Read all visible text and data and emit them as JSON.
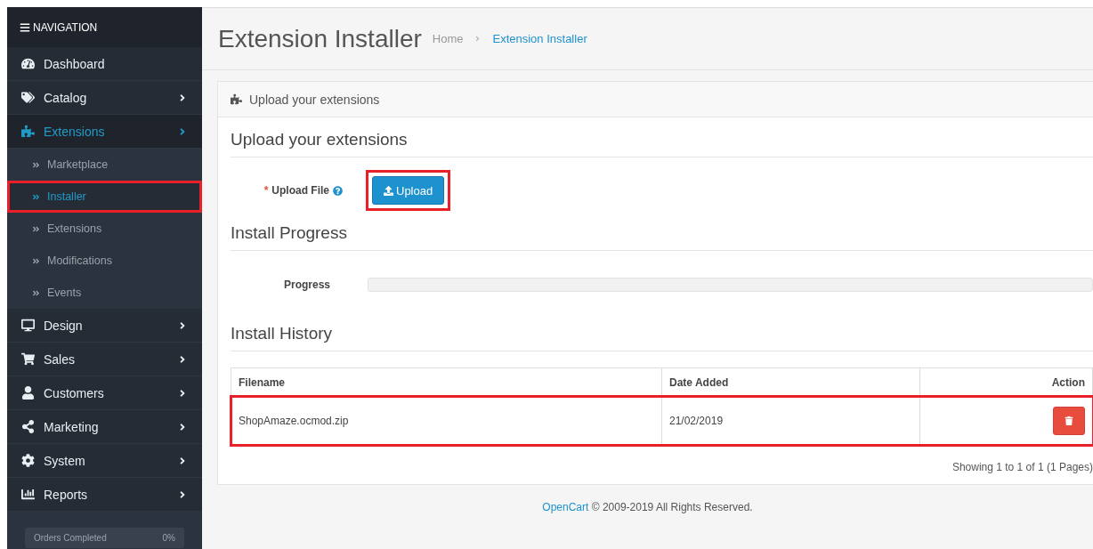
{
  "sidebar": {
    "header": "NAVIGATION",
    "items": [
      {
        "label": "Dashboard",
        "has_submenu": false,
        "selected": false
      },
      {
        "label": "Catalog",
        "has_submenu": true,
        "selected": false
      },
      {
        "label": "Extensions",
        "has_submenu": true,
        "expanded": true,
        "selected": true,
        "children": [
          {
            "label": "Marketplace",
            "selected": false,
            "highlighted": false
          },
          {
            "label": "Installer",
            "selected": true,
            "highlighted": true
          },
          {
            "label": "Extensions",
            "selected": false,
            "highlighted": false
          },
          {
            "label": "Modifications",
            "selected": false,
            "highlighted": false
          },
          {
            "label": "Events",
            "selected": false,
            "highlighted": false
          }
        ]
      },
      {
        "label": "Design",
        "has_submenu": true,
        "selected": false
      },
      {
        "label": "Sales",
        "has_submenu": true,
        "selected": false
      },
      {
        "label": "Customers",
        "has_submenu": true,
        "selected": false
      },
      {
        "label": "Marketing",
        "has_submenu": true,
        "selected": false
      },
      {
        "label": "System",
        "has_submenu": true,
        "selected": false
      },
      {
        "label": "Reports",
        "has_submenu": true,
        "selected": false
      }
    ],
    "stat": {
      "label": "Orders Completed",
      "value": "0%"
    }
  },
  "page": {
    "title": "Extension Installer",
    "breadcrumb": [
      {
        "label": "Home",
        "selected": false
      },
      {
        "label": "Extension Installer",
        "selected": true
      }
    ]
  },
  "panel": {
    "title": "Upload your extensions",
    "upload_section": {
      "heading": "Upload your extensions",
      "label": "Upload File",
      "required_mark": "*",
      "button": "Upload",
      "highlighted": true
    },
    "progress_section": {
      "heading": "Install Progress",
      "label": "Progress",
      "level": 0
    },
    "history_section": {
      "heading": "Install History",
      "columns": [
        "Filename",
        "Date Added",
        "Action"
      ],
      "rows": [
        {
          "filename": "ShopAmaze.ocmod.zip",
          "date_added": "21/02/2019",
          "highlighted": true
        }
      ],
      "pagination": "Showing 1 to 1 of 1 (1 Pages)"
    }
  },
  "footer": {
    "link": "OpenCart",
    "text": "© 2009-2019 All Rights Reserved."
  }
}
